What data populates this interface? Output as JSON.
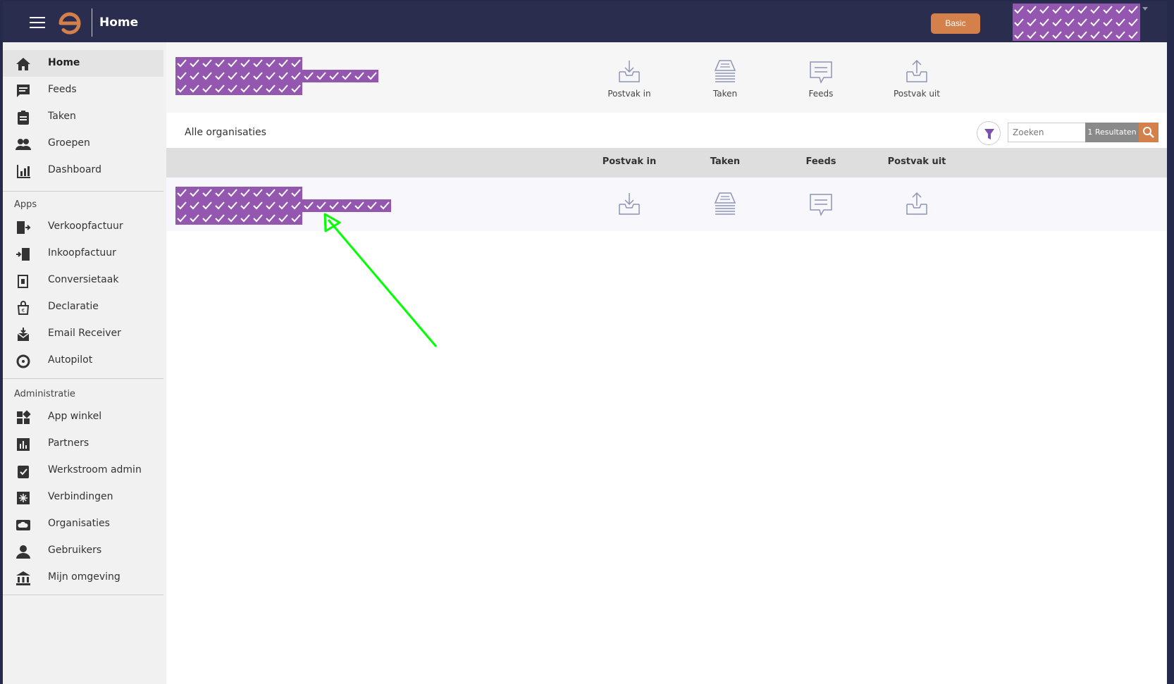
{
  "topbar": {
    "title": "Home",
    "plan_button": "Basic"
  },
  "sidebar": {
    "main_items": [
      {
        "label": "Home",
        "icon": "home-icon",
        "active": true
      },
      {
        "label": "Feeds",
        "icon": "feeds-icon"
      },
      {
        "label": "Taken",
        "icon": "tasks-icon"
      },
      {
        "label": "Groepen",
        "icon": "groups-icon"
      },
      {
        "label": "Dashboard",
        "icon": "dashboard-icon"
      }
    ],
    "apps_title": "Apps",
    "apps_items": [
      {
        "label": "Verkoopfactuur",
        "icon": "sales-invoice-icon"
      },
      {
        "label": "Inkoopfactuur",
        "icon": "purchase-invoice-icon"
      },
      {
        "label": "Conversietaak",
        "icon": "conversion-icon"
      },
      {
        "label": "Declaratie",
        "icon": "expense-icon"
      },
      {
        "label": "Email Receiver",
        "icon": "email-receiver-icon"
      },
      {
        "label": "Autopilot",
        "icon": "autopilot-icon"
      }
    ],
    "admin_title": "Administratie",
    "admin_items": [
      {
        "label": "App winkel",
        "icon": "app-store-icon"
      },
      {
        "label": "Partners",
        "icon": "partners-icon"
      },
      {
        "label": "Werkstroom admin",
        "icon": "workflow-icon"
      },
      {
        "label": "Verbindingen",
        "icon": "connections-icon"
      },
      {
        "label": "Organisaties",
        "icon": "organisations-icon"
      },
      {
        "label": "Gebruikers",
        "icon": "users-icon"
      },
      {
        "label": "Mijn omgeving",
        "icon": "environment-icon"
      }
    ]
  },
  "summary": {
    "items": [
      {
        "label": "Postvak in",
        "icon": "inbox-icon"
      },
      {
        "label": "Taken",
        "icon": "tasks-stack-icon"
      },
      {
        "label": "Feeds",
        "icon": "chat-icon"
      },
      {
        "label": "Postvak uit",
        "icon": "outbox-icon"
      }
    ]
  },
  "list": {
    "title": "Alle organisaties",
    "search_placeholder": "Zoeken",
    "results": "1 Resultaten",
    "columns": [
      "Postvak in",
      "Taken",
      "Feeds",
      "Postvak uit"
    ]
  },
  "colors": {
    "topbar": "#2b2d4f",
    "accent": "#d4804a",
    "redaction": "#9457b0",
    "annotation_arrow": "#00ff00"
  }
}
